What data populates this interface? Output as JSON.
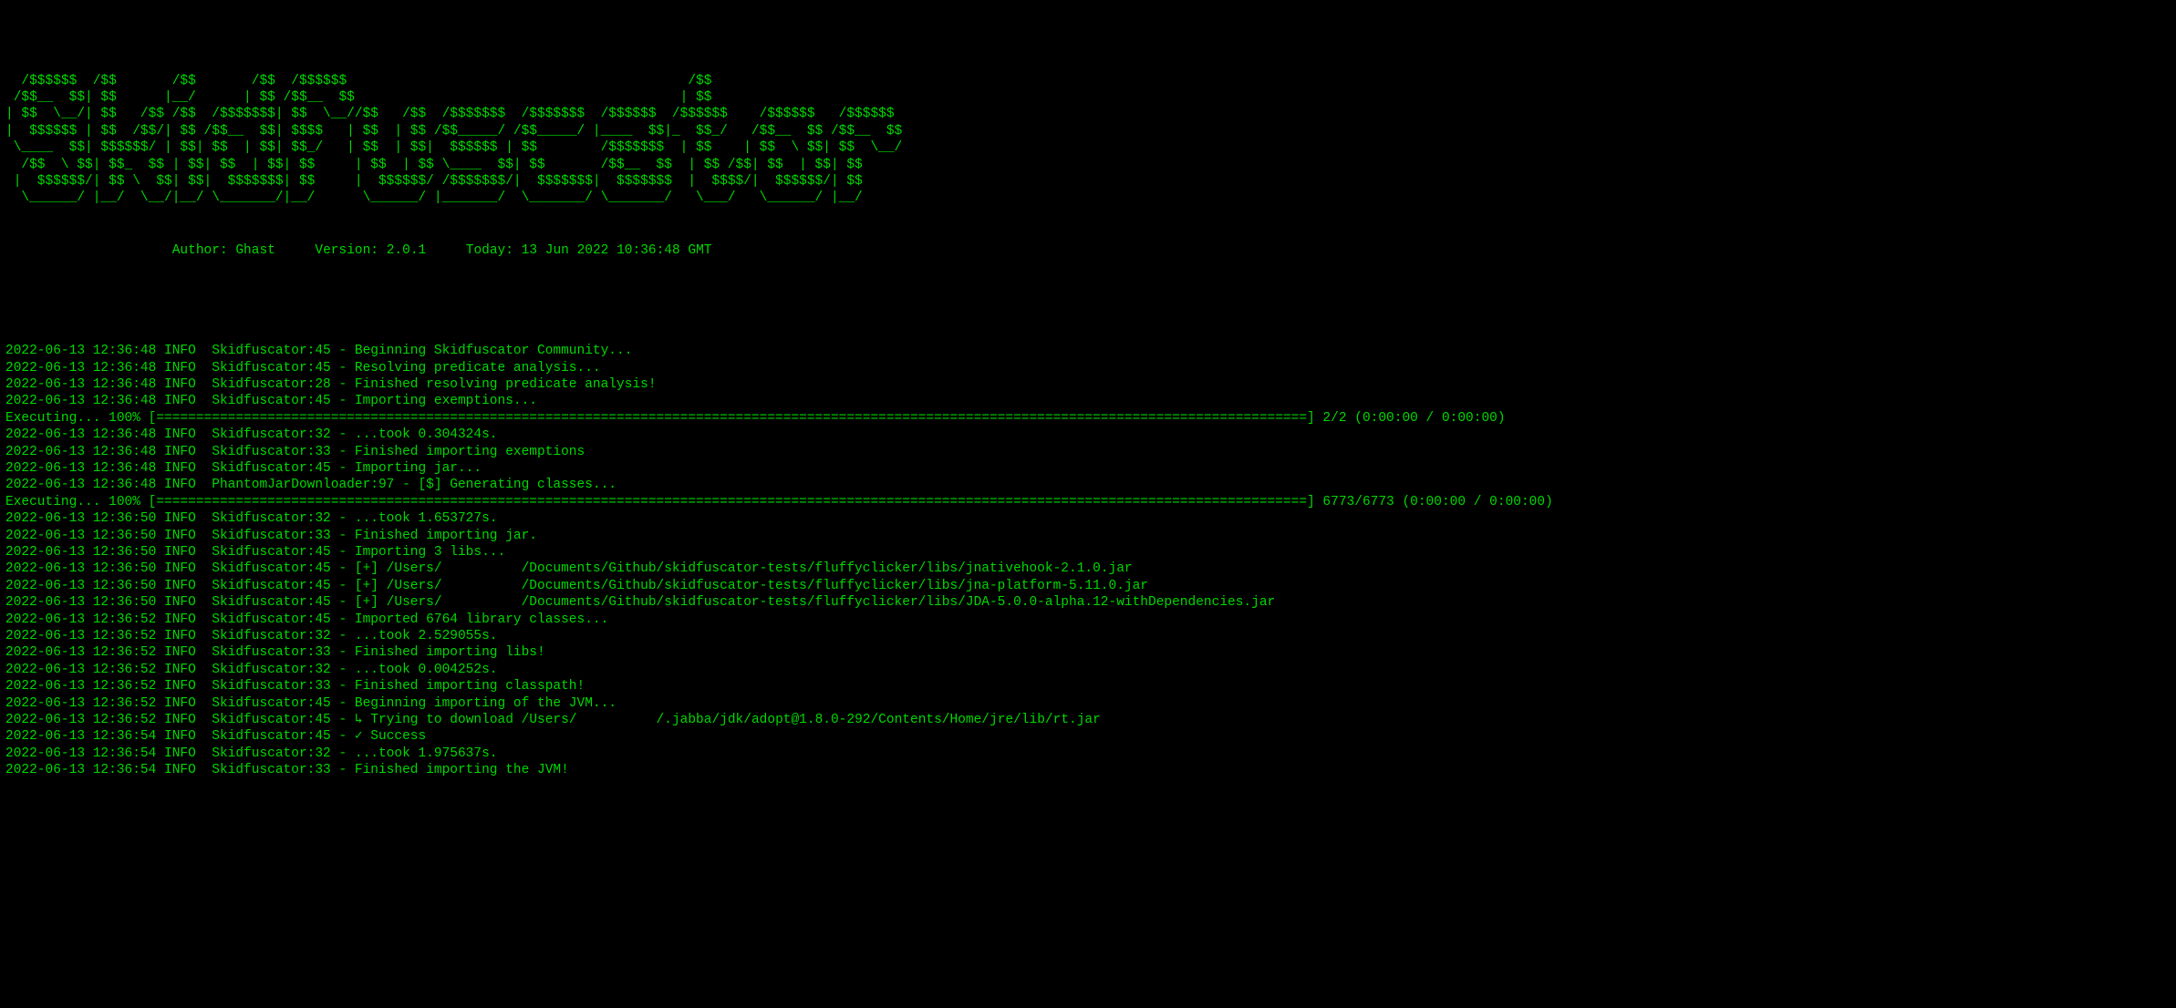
{
  "ascii_art": "  /$$$$$$  /$$       /$$       /$$  /$$$$$$                                           /$$\n /$$__  $$| $$      |__/      | $$ /$$__  $$                                         | $$\n| $$  \\__/| $$   /$$ /$$  /$$$$$$$| $$  \\__//$$   /$$  /$$$$$$$  /$$$$$$$  /$$$$$$  /$$$$$$    /$$$$$$   /$$$$$$\n|  $$$$$$ | $$  /$$/| $$ /$$__  $$| $$$$   | $$  | $$ /$$_____/ /$$_____/ |____  $$|_  $$_/   /$$__  $$ /$$__  $$\n \\____  $$| $$$$$$/ | $$| $$  | $$| $$_/   | $$  | $$|  $$$$$$ | $$        /$$$$$$$  | $$    | $$  \\ $$| $$  \\__/\n  /$$  \\ $$| $$_  $$ | $$| $$  | $$| $$     | $$  | $$ \\____  $$| $$       /$$__  $$  | $$ /$$| $$  | $$| $$\n |  $$$$$$/| $$ \\  $$| $$|  $$$$$$$| $$     |  $$$$$$/ /$$$$$$$/|  $$$$$$$|  $$$$$$$  |  $$$$/|  $$$$$$/| $$\n  \\______/ |__/  \\__/|__/ \\_______/|__/      \\______/ |_______/  \\_______/ \\_______/   \\___/   \\______/ |__/",
  "header": {
    "author_label": "Author:",
    "author_value": "Ghast",
    "version_label": "Version:",
    "version_value": "2.0.1",
    "today_label": "Today:",
    "today_value": "13 Jun 2022 10:36:48 GMT"
  },
  "logs": [
    {
      "ts": "2022-06-13 12:36:48",
      "level": "INFO",
      "logger": "Skidfuscator:45",
      "msg": "Beginning Skidfuscator Community..."
    },
    {
      "ts": "2022-06-13 12:36:48",
      "level": "INFO",
      "logger": "Skidfuscator:45",
      "msg": "Resolving predicate analysis..."
    },
    {
      "ts": "2022-06-13 12:36:48",
      "level": "INFO",
      "logger": "Skidfuscator:28",
      "msg": "Finished resolving predicate analysis!"
    },
    {
      "ts": "2022-06-13 12:36:48",
      "level": "INFO",
      "logger": "Skidfuscator:45",
      "msg": "Importing exemptions..."
    },
    {
      "type": "progress",
      "prefix": "Executing... 100% [",
      "suffix": "] 2/2 (0:00:00 / 0:00:00)"
    },
    {
      "ts": "2022-06-13 12:36:48",
      "level": "INFO",
      "logger": "Skidfuscator:32",
      "msg": "...took 0.304324s."
    },
    {
      "ts": "2022-06-13 12:36:48",
      "level": "INFO",
      "logger": "Skidfuscator:33",
      "msg": "Finished importing exemptions"
    },
    {
      "ts": "2022-06-13 12:36:48",
      "level": "INFO",
      "logger": "Skidfuscator:45",
      "msg": "Importing jar..."
    },
    {
      "ts": "2022-06-13 12:36:48",
      "level": "INFO",
      "logger": "PhantomJarDownloader:97",
      "msg": "[$] Generating classes..."
    },
    {
      "type": "progress",
      "prefix": "Executing... 100% [",
      "suffix": "] 6773/6773 (0:00:00 / 0:00:00)"
    },
    {
      "ts": "2022-06-13 12:36:50",
      "level": "INFO",
      "logger": "Skidfuscator:32",
      "msg": "...took 1.653727s."
    },
    {
      "ts": "2022-06-13 12:36:50",
      "level": "INFO",
      "logger": "Skidfuscator:33",
      "msg": "Finished importing jar."
    },
    {
      "ts": "2022-06-13 12:36:50",
      "level": "INFO",
      "logger": "Skidfuscator:45",
      "msg": "Importing 3 libs..."
    },
    {
      "ts": "2022-06-13 12:36:50",
      "level": "INFO",
      "logger": "Skidfuscator:45",
      "msg": "[+] /Users/          /Documents/Github/skidfuscator-tests/fluffyclicker/libs/jnativehook-2.1.0.jar"
    },
    {
      "ts": "2022-06-13 12:36:50",
      "level": "INFO",
      "logger": "Skidfuscator:45",
      "msg": "[+] /Users/          /Documents/Github/skidfuscator-tests/fluffyclicker/libs/jna-platform-5.11.0.jar"
    },
    {
      "ts": "2022-06-13 12:36:50",
      "level": "INFO",
      "logger": "Skidfuscator:45",
      "msg": "[+] /Users/          /Documents/Github/skidfuscator-tests/fluffyclicker/libs/JDA-5.0.0-alpha.12-withDependencies.jar"
    },
    {
      "ts": "2022-06-13 12:36:52",
      "level": "INFO",
      "logger": "Skidfuscator:45",
      "msg": "Imported 6764 library classes..."
    },
    {
      "ts": "2022-06-13 12:36:52",
      "level": "INFO",
      "logger": "Skidfuscator:32",
      "msg": "...took 2.529055s."
    },
    {
      "ts": "2022-06-13 12:36:52",
      "level": "INFO",
      "logger": "Skidfuscator:33",
      "msg": "Finished importing libs!"
    },
    {
      "ts": "2022-06-13 12:36:52",
      "level": "INFO",
      "logger": "Skidfuscator:32",
      "msg": "...took 0.004252s."
    },
    {
      "ts": "2022-06-13 12:36:52",
      "level": "INFO",
      "logger": "Skidfuscator:33",
      "msg": "Finished importing classpath!"
    },
    {
      "ts": "2022-06-13 12:36:52",
      "level": "INFO",
      "logger": "Skidfuscator:45",
      "msg": "Beginning importing of the JVM..."
    },
    {
      "ts": "2022-06-13 12:36:52",
      "level": "INFO",
      "logger": "Skidfuscator:45",
      "msg": "↳ Trying to download /Users/          /.jabba/jdk/adopt@1.8.0-292/Contents/Home/jre/lib/rt.jar"
    },
    {
      "ts": "2022-06-13 12:36:54",
      "level": "INFO",
      "logger": "Skidfuscator:45",
      "msg": "✓ Success"
    },
    {
      "ts": "2022-06-13 12:36:54",
      "level": "INFO",
      "logger": "Skidfuscator:32",
      "msg": "...took 1.975637s."
    },
    {
      "ts": "2022-06-13 12:36:54",
      "level": "INFO",
      "logger": "Skidfuscator:33",
      "msg": "Finished importing the JVM!"
    }
  ],
  "progress_bar_width": 145
}
